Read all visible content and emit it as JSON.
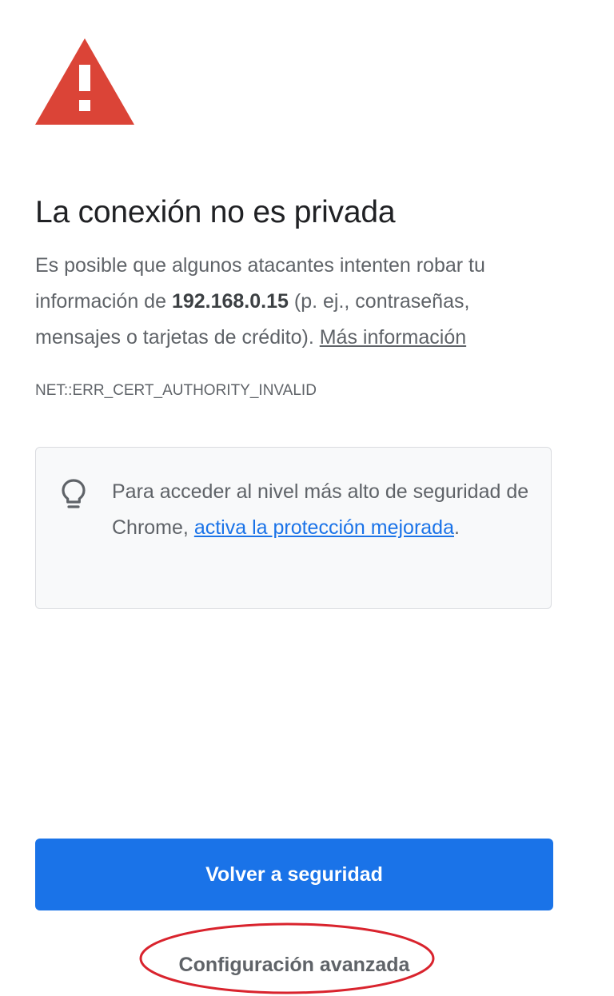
{
  "colors": {
    "warning": "#db4437",
    "link": "#1a73e8",
    "primary_button": "#1a73e8",
    "annotation": "#d9232d"
  },
  "icons": {
    "warning": "warning-triangle-icon",
    "tip": "lightbulb-icon"
  },
  "title": "La conexión no es privada",
  "explanation": {
    "text_before": "Es posible que algunos atacantes intenten robar tu información de ",
    "host": "192.168.0.15",
    "text_after": " (p. ej., contraseñas, mensajes o tarjetas de crédito). ",
    "learn_more": "Más información"
  },
  "error_code": "NET::ERR_CERT_AUTHORITY_INVALID",
  "tip": {
    "text_before": "Para acceder al nivel más alto de seguridad de Chrome, ",
    "link": "activa la protección mejorada",
    "text_after": "."
  },
  "buttons": {
    "primary": "Volver a seguridad",
    "secondary": "Configuración avanzada"
  }
}
